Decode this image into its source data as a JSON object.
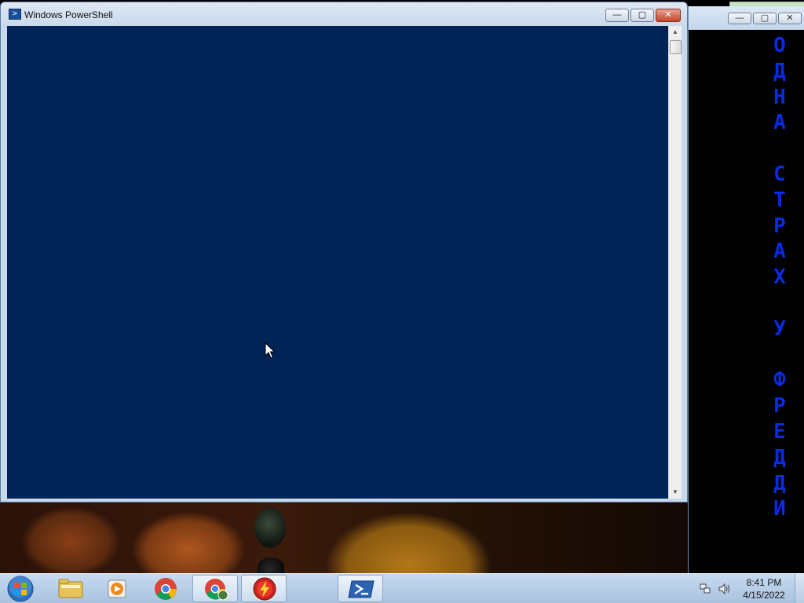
{
  "powershell_window": {
    "title": "Windows PowerShell",
    "minimize_glyph": "—",
    "maximize_glyph": "▢",
    "close_glyph": "✕",
    "console_bg": "#012456"
  },
  "background_window": {
    "side_text": "О\nД\nН\nА\n\nС\nТ\nР\nА\nХ\n\nУ\n\nФ\nР\nЕ\nД\nД\nИ",
    "text_color": "#0a2ce0",
    "minimize_glyph": "—",
    "maximize_glyph": "▢",
    "close_glyph": "✕"
  },
  "taskbar": {
    "items": [
      {
        "name": "windows-explorer",
        "icon": "folder-icon"
      },
      {
        "name": "media-player",
        "icon": "media-player-icon"
      },
      {
        "name": "chrome",
        "icon": "chrome-icon"
      },
      {
        "name": "chrome-user",
        "icon": "chrome-user-icon"
      },
      {
        "name": "antivirus",
        "icon": "lightning-icon"
      },
      {
        "name": "powershell",
        "icon": "powershell-icon"
      }
    ],
    "clock_time": "8:41 PM",
    "clock_date": "4/15/2022"
  }
}
